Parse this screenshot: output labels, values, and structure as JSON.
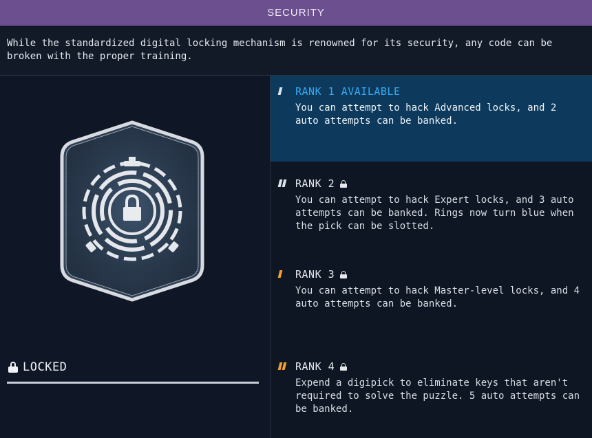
{
  "header": {
    "title": "SECURITY"
  },
  "description": "While the standardized digital locking mechanism is renowned for its security, any code can be broken with the proper training.",
  "status": {
    "label": "LOCKED",
    "icon": "lock-icon"
  },
  "skill_icon": "security-lock-badge-icon",
  "colors": {
    "title_bar": "#6b4f8f",
    "active_rank_bg": "#0d3a5c",
    "active_rank_text": "#36a8f0",
    "rank_marker_white": "#dfe3ea",
    "rank_marker_orange": "#f0a030",
    "background": "#0e1624"
  },
  "ranks": [
    {
      "name": "RANK 1 AVAILABLE",
      "text": "You can attempt to hack Advanced locks, and 2 auto attempts can be banked.",
      "locked": false,
      "active": true,
      "marker": {
        "count": 1,
        "color": "white"
      }
    },
    {
      "name": "RANK 2",
      "text": "You can attempt to hack Expert locks, and 3 auto attempts can be banked. Rings now turn blue when the pick can be slotted.",
      "locked": true,
      "active": false,
      "marker": {
        "count": 2,
        "color": "white"
      }
    },
    {
      "name": "RANK 3",
      "text": "You can attempt to hack Master-level locks, and 4 auto attempts can be banked.",
      "locked": true,
      "active": false,
      "marker": {
        "count": 1,
        "color": "orange"
      }
    },
    {
      "name": "RANK 4",
      "text": "Expend a digipick to eliminate keys that aren't required to solve the puzzle. 5 auto attempts can be banked.",
      "locked": true,
      "active": false,
      "marker": {
        "count": 2,
        "color": "orange"
      }
    }
  ]
}
